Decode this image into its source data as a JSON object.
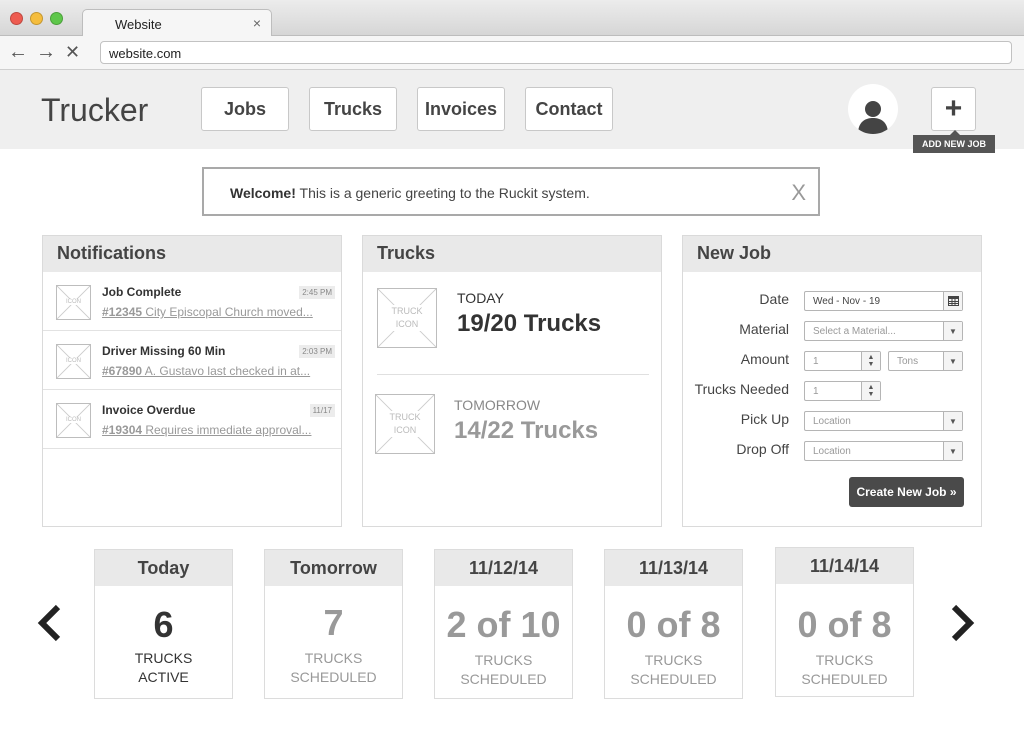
{
  "browser": {
    "tab_title": "Website",
    "tab_close": "×",
    "url": "website.com",
    "nav": {
      "back": "←",
      "forward": "→",
      "stop": "✕"
    }
  },
  "header": {
    "logo": "Trucker",
    "nav_items": [
      {
        "label": "Jobs"
      },
      {
        "label": "Trucks"
      },
      {
        "label": "Invoices"
      },
      {
        "label": "Contact"
      }
    ],
    "add_icon": "+",
    "add_tooltip": "ADD NEW JOB"
  },
  "welcome": {
    "bold": "Welcome!",
    "text": " This is a generic greeting to the Ruckit system.",
    "close": "X"
  },
  "notifications": {
    "title": "Notifications",
    "icon_label": "ICON",
    "items": [
      {
        "title": "Job Complete",
        "time": "2:45 PM",
        "ref": "#12345",
        "desc": " City Episcopal Church moved..."
      },
      {
        "title": "Driver Missing 60 Min",
        "time": "2:03 PM",
        "ref": "#67890",
        "desc": " A. Gustavo last checked in at..."
      },
      {
        "title": "Invoice Overdue",
        "time": "11/17",
        "ref": "#19304",
        "desc": " Requires immediate approval..."
      }
    ]
  },
  "trucks": {
    "title": "Trucks",
    "icon_line1": "TRUCK",
    "icon_line2": "ICON",
    "today_label": "TODAY",
    "today_count": "19/20 Trucks",
    "tomorrow_label": "TOMORROW",
    "tomorrow_count": "14/22 Trucks"
  },
  "new_job": {
    "title": "New Job",
    "labels": {
      "date": "Date",
      "material": "Material",
      "amount": "Amount",
      "trucks_needed": "Trucks Needed",
      "pick_up": "Pick Up",
      "drop_off": "Drop Off"
    },
    "date_value": "Wed - Nov - 19",
    "material_placeholder": "Select a Material...",
    "amount_value": "1",
    "amount_unit": "Tons",
    "trucks_needed_value": "1",
    "pick_up_placeholder": "Location",
    "drop_off_placeholder": "Location",
    "submit": "Create New Job »"
  },
  "days": [
    {
      "head": "Today",
      "num": "6",
      "line1": "TRUCKS",
      "line2": "ACTIVE"
    },
    {
      "head": "Tomorrow",
      "num": "7",
      "line1": "TRUCKS",
      "line2": "SCHEDULED"
    },
    {
      "head": "11/12/14",
      "num": "2 of 10",
      "line1": "TRUCKS",
      "line2": "SCHEDULED"
    },
    {
      "head": "11/13/14",
      "num": "0 of 8",
      "line1": "TRUCKS",
      "line2": "SCHEDULED"
    },
    {
      "head": "11/14/14",
      "num": "0 of 8",
      "line1": "TRUCKS",
      "line2": "SCHEDULED"
    }
  ],
  "carousel": {
    "prev": "‹",
    "next": "›"
  },
  "colors": {
    "header_bg": "#efefef",
    "panel_head": "#e9e9e9",
    "button_dark": "#4a4a4a",
    "muted": "#999999"
  }
}
